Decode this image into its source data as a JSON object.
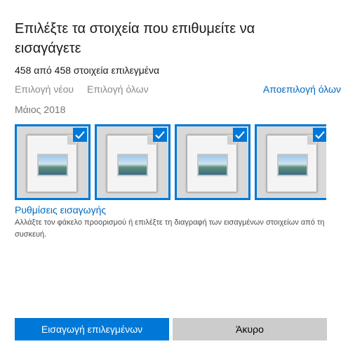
{
  "dialog": {
    "title": "Επιλέξτε τα στοιχεία που επιθυμείτε να εισαγάγετε",
    "count_text": "458 από 458 στοιχεία επιλεγμένα",
    "select_new": "Επιλογή νέου",
    "select_all": "Επιλογή όλων",
    "deselect_all": "Αποεπιλογή όλων",
    "group_date": "Μάιος 2018",
    "settings_link": "Ρυθμίσεις εισαγωγής",
    "settings_desc": "Αλλάξτε τον φάκελο προορισμού ή επιλέξτε τη διαγραφή των εισαγμένων στοιχείων από τη συσκευή.",
    "import_button": "Εισαγωγή επιλεγμένων",
    "cancel_button": "Άκυρο"
  },
  "thumbnails": [
    {
      "icon": "image-file-icon",
      "selected": true
    },
    {
      "icon": "image-file-icon",
      "selected": true
    },
    {
      "icon": "image-file-icon",
      "selected": true
    },
    {
      "icon": "image-file-icon",
      "selected": true
    }
  ],
  "colors": {
    "accent": "#0078d7",
    "link": "#0067c0",
    "disabled_text": "#8a8a8a",
    "secondary_button": "#cccccc"
  }
}
